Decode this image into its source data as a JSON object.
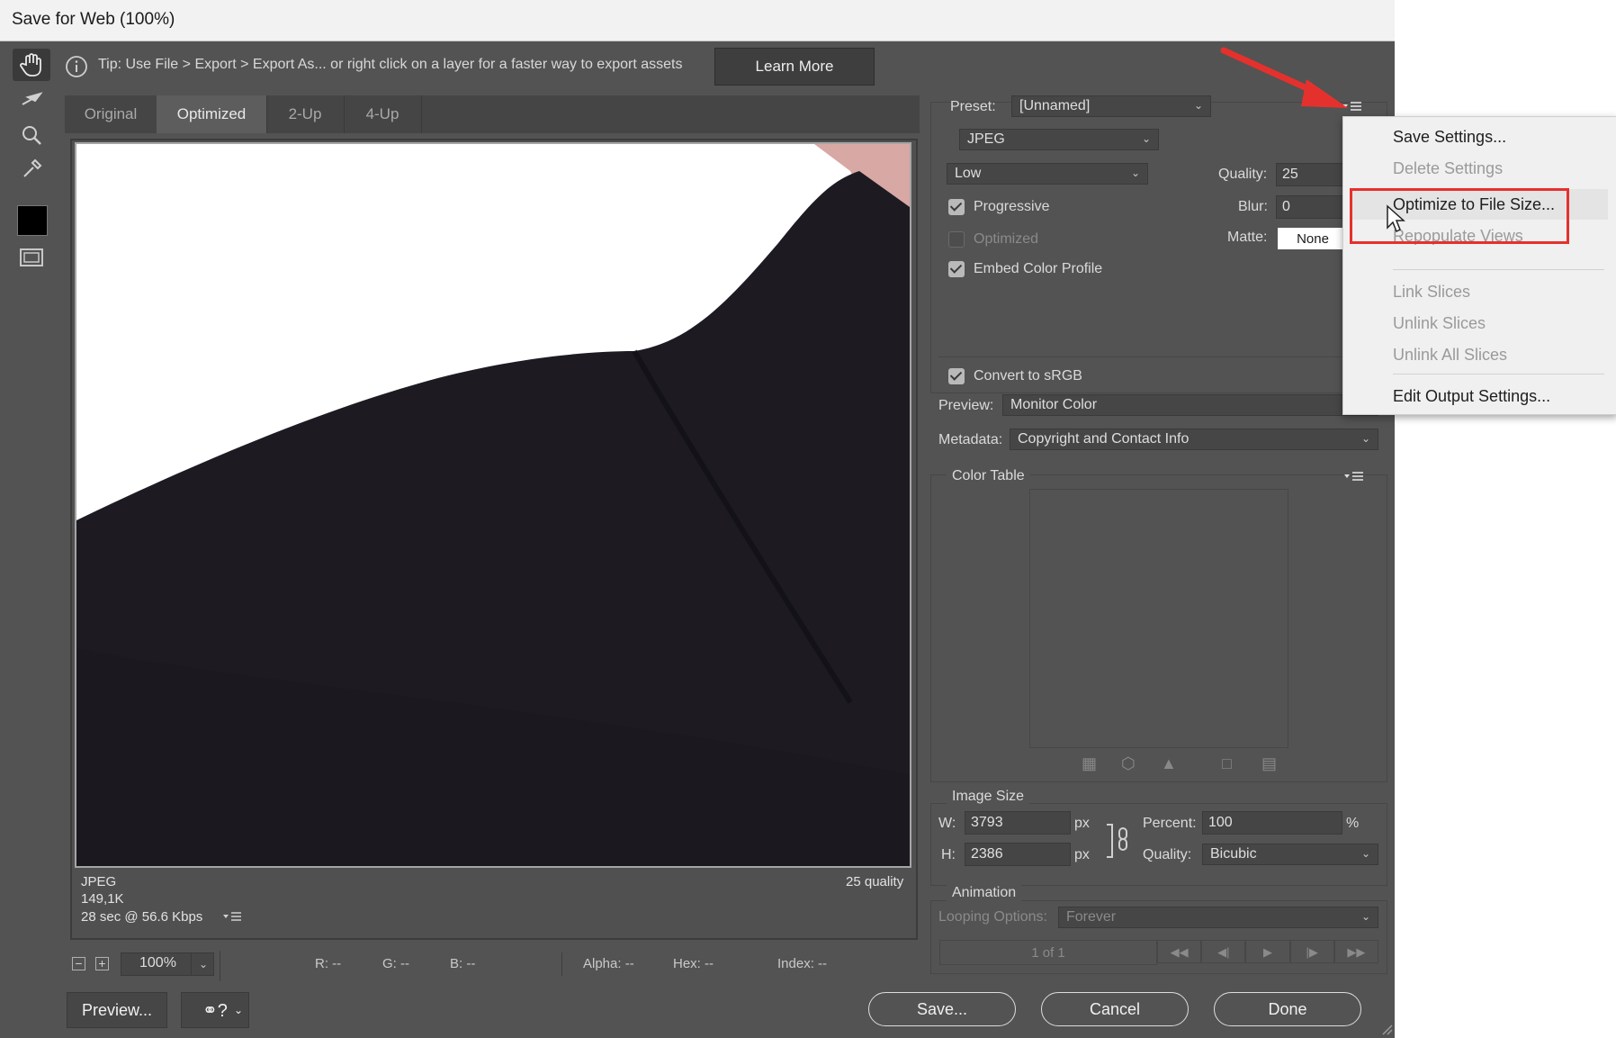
{
  "window": {
    "title": "Save for Web (100%)"
  },
  "tip": {
    "text": "Tip: Use File > Export > Export As...  or right click on a layer for a faster way to export assets",
    "learn_more": "Learn More"
  },
  "tabs": [
    "Original",
    "Optimized",
    "2-Up",
    "4-Up"
  ],
  "image_info": {
    "format": "JPEG",
    "size": "149,1K",
    "time": "28 sec @ 56.6 Kbps",
    "quality": "25 quality"
  },
  "status": {
    "zoom": "100%",
    "r": "R: --",
    "g": "G: --",
    "b": "B: --",
    "alpha": "Alpha: --",
    "hex": "Hex: --",
    "index": "Index: --"
  },
  "buttons": {
    "preview": "Preview...",
    "save": "Save...",
    "cancel": "Cancel",
    "done": "Done"
  },
  "settings": {
    "preset_label": "Preset:",
    "preset_value": "[Unnamed]",
    "format": "JPEG",
    "quality_level": "Low",
    "quality_label": "Quality:",
    "quality_value": "25",
    "blur_label": "Blur:",
    "blur_value": "0",
    "matte_label": "Matte:",
    "matte_value": "None",
    "progressive": "Progressive",
    "optimized": "Optimized",
    "embed_profile": "Embed Color Profile",
    "convert_srgb": "Convert to sRGB",
    "preview_label": "Preview:",
    "preview_value": "Monitor Color",
    "metadata_label": "Metadata:",
    "metadata_value": "Copyright and Contact Info"
  },
  "checkboxes": {
    "progressive": true,
    "optimized": false,
    "embed_profile": true,
    "convert_srgb": true
  },
  "color_table": {
    "title": "Color Table"
  },
  "image_size": {
    "title": "Image Size",
    "w_label": "W:",
    "w_value": "3793",
    "h_label": "H:",
    "h_value": "2386",
    "unit": "px",
    "percent_label": "Percent:",
    "percent_value": "100",
    "percent_unit": "%",
    "quality_label": "Quality:",
    "quality_value": "Bicubic"
  },
  "animation": {
    "title": "Animation",
    "looping_label": "Looping Options:",
    "looping_value": "Forever",
    "frame": "1 of 1"
  },
  "menu": {
    "items": [
      {
        "label": "Save Settings...",
        "enabled": true
      },
      {
        "label": "Delete Settings",
        "enabled": false
      },
      {
        "label": "Optimize to File Size...",
        "enabled": true
      },
      {
        "label": "Repopulate Views",
        "enabled": false
      },
      {
        "label": "Link Slices",
        "enabled": false
      },
      {
        "label": "Unlink Slices",
        "enabled": false
      },
      {
        "label": "Unlink All Slices",
        "enabled": false
      },
      {
        "label": "Edit Output Settings...",
        "enabled": true
      }
    ]
  },
  "colors": {
    "annotation_red": "#e5312d",
    "panel_bg": "#535353",
    "menu_bg": "#f0f0f0"
  }
}
